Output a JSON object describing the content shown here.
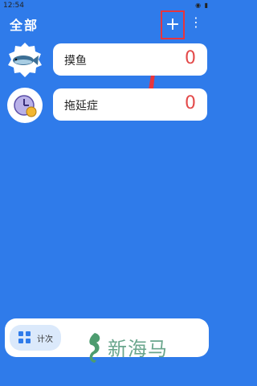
{
  "status_bar": {
    "time": "12:54",
    "icons": "◉ ▮"
  },
  "header": {
    "title": "全部",
    "add_label": "+",
    "more_label": "⋮"
  },
  "counters": [
    {
      "label": "摸鱼",
      "count": "0",
      "icon": "fish-icon"
    },
    {
      "label": "拖延症",
      "count": "0",
      "icon": "clock-icon"
    }
  ],
  "bottom_bar": {
    "tab_label": "计次",
    "tab_icon": "grid-icon"
  },
  "watermark": {
    "text": "新海马"
  },
  "colors": {
    "background": "#2f7bea",
    "count": "#e34a4a",
    "highlight": "#e8353c"
  }
}
